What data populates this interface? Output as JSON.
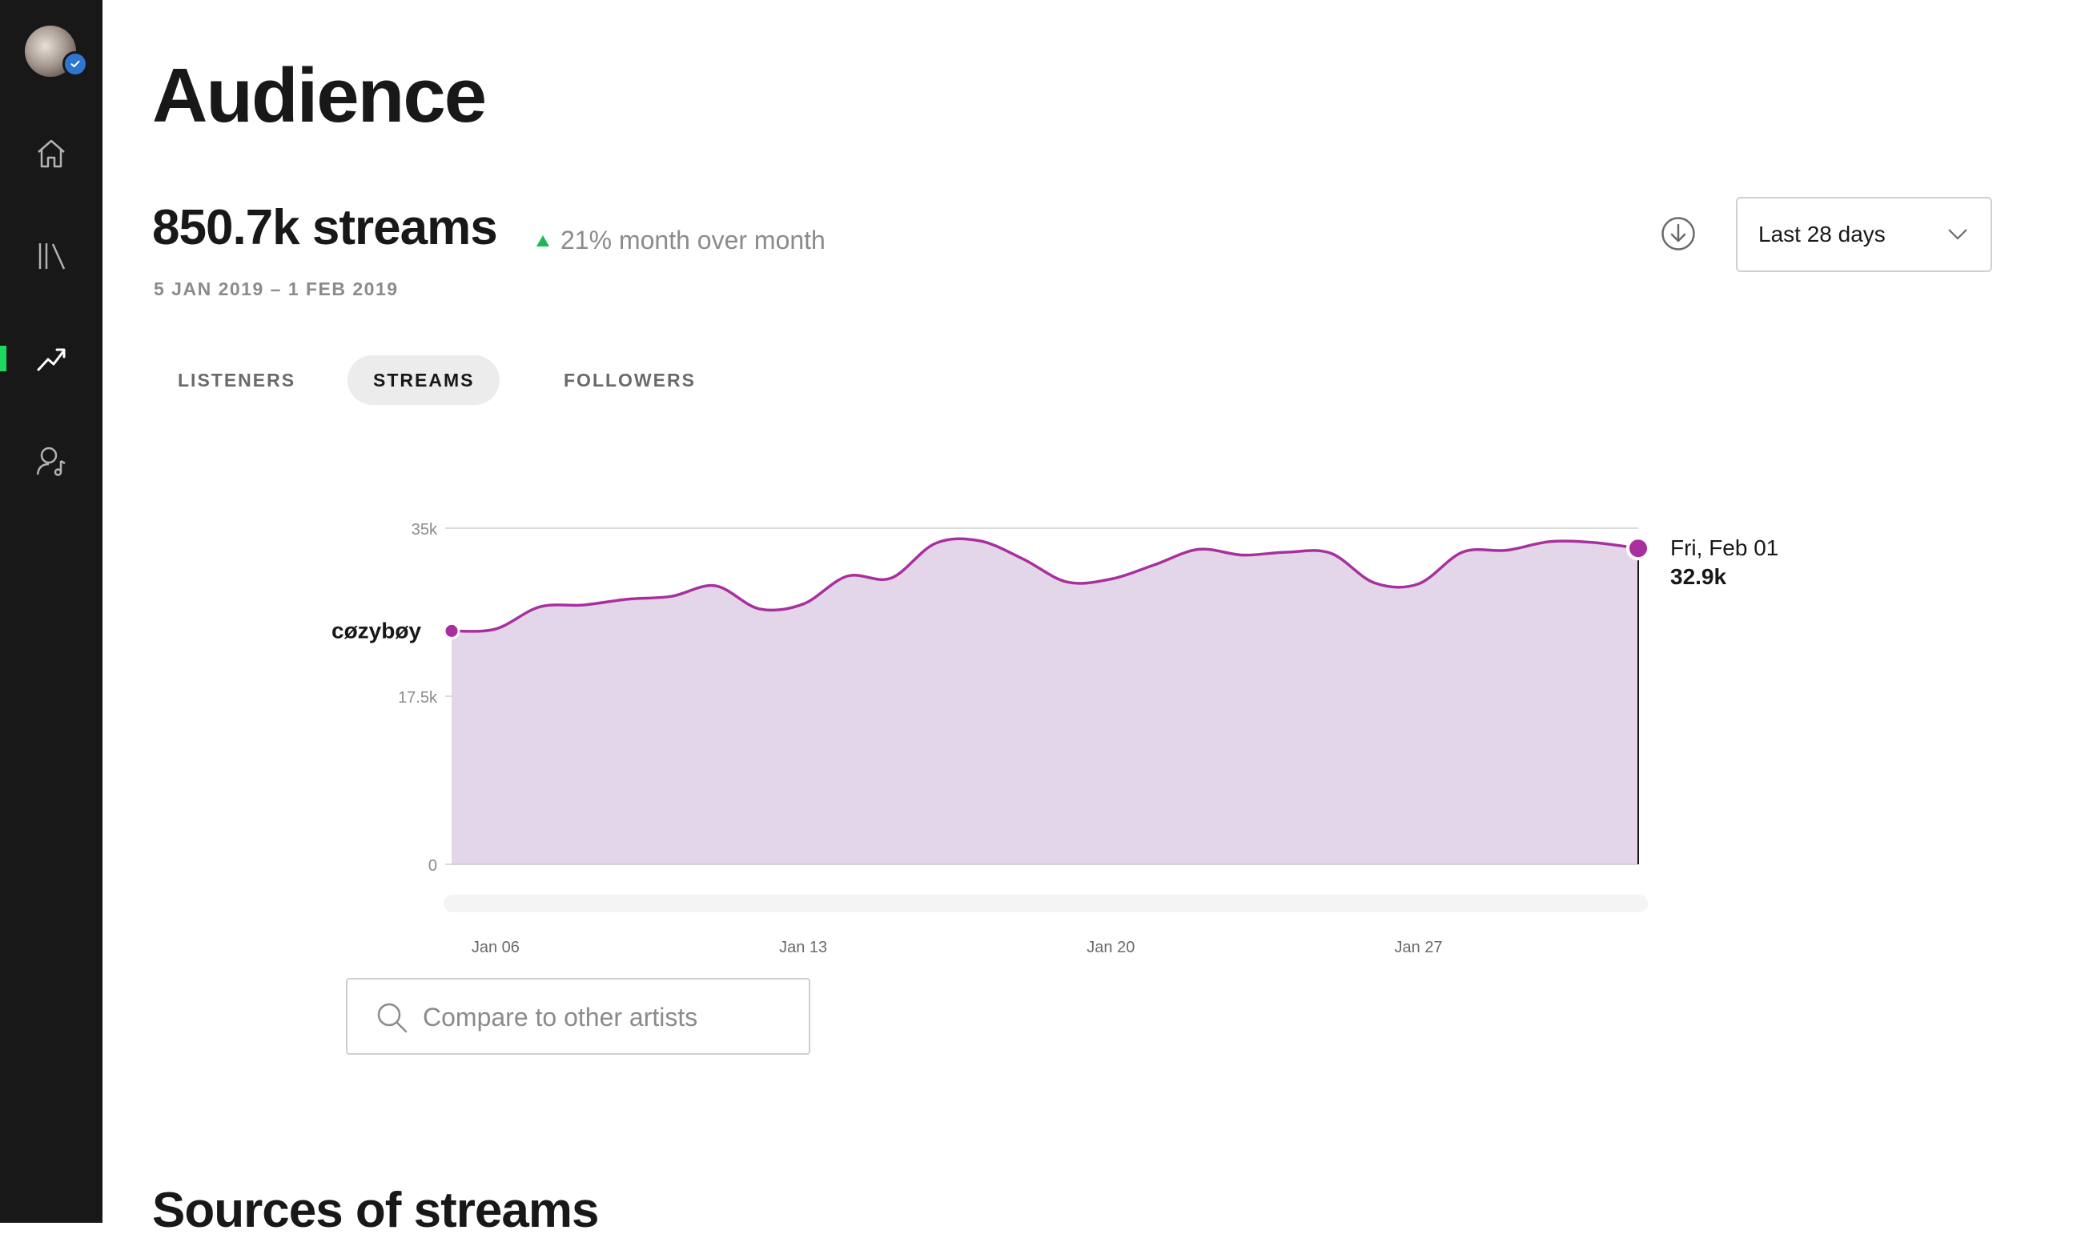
{
  "page": {
    "title": "Audience",
    "section_title": "Sources of streams"
  },
  "summary": {
    "headline": "850.7k streams",
    "delta": "21% month over month",
    "date_range": "5 JAN 2019 – 1 FEB 2019"
  },
  "controls": {
    "range_selected": "Last 28 days"
  },
  "tabs": [
    {
      "label": "LISTENERS",
      "active": false
    },
    {
      "label": "STREAMS",
      "active": true
    },
    {
      "label": "FOLLOWERS",
      "active": false
    }
  ],
  "search": {
    "placeholder": "Compare to other artists"
  },
  "colors": {
    "accent": "#a8309e",
    "area_fill": "#e4d6e9",
    "positive": "#1db954",
    "sidebar_bg": "#181818",
    "nav_active": "#1ed760"
  },
  "nav_icons": [
    "home-icon",
    "library-icon",
    "stats-icon",
    "artist-icon"
  ],
  "chart_data": {
    "type": "area",
    "series": [
      {
        "name": "cøzybøy",
        "x": [
          "Jan 05",
          "Jan 06",
          "Jan 07",
          "Jan 08",
          "Jan 09",
          "Jan 10",
          "Jan 11",
          "Jan 12",
          "Jan 13",
          "Jan 14",
          "Jan 15",
          "Jan 16",
          "Jan 17",
          "Jan 18",
          "Jan 19",
          "Jan 20",
          "Jan 21",
          "Jan 22",
          "Jan 23",
          "Jan 24",
          "Jan 25",
          "Jan 26",
          "Jan 27",
          "Jan 28",
          "Jan 29",
          "Jan 30",
          "Jan 31",
          "Feb 01"
        ],
        "values": [
          24.3,
          24.5,
          26.8,
          27.0,
          27.6,
          27.9,
          29.0,
          26.6,
          27.1,
          30.0,
          29.8,
          33.4,
          33.7,
          31.8,
          29.4,
          29.7,
          31.2,
          32.8,
          32.2,
          32.5,
          32.4,
          29.3,
          29.2,
          32.5,
          32.7,
          33.6,
          33.5,
          32.9
        ]
      }
    ],
    "x_ticks": [
      "Jan 06",
      "Jan 13",
      "Jan 20",
      "Jan 27"
    ],
    "y_ticks": [
      "0",
      "17.5k",
      "35k"
    ],
    "ylim": [
      0,
      35
    ],
    "grid": true,
    "tooltip": {
      "date": "Fri, Feb 01",
      "value": "32.9k"
    }
  }
}
